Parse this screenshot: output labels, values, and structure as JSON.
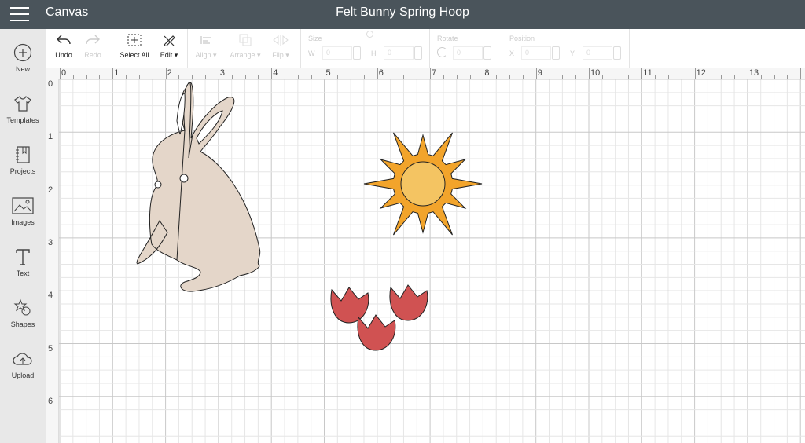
{
  "header": {
    "app": "Canvas",
    "title": "Felt Bunny Spring Hoop"
  },
  "sidebar": {
    "items": [
      {
        "label": "New",
        "icon": "plus-circle-icon"
      },
      {
        "label": "Templates",
        "icon": "tshirt-icon"
      },
      {
        "label": "Projects",
        "icon": "notebook-icon"
      },
      {
        "label": "Images",
        "icon": "image-icon"
      },
      {
        "label": "Text",
        "icon": "text-icon"
      },
      {
        "label": "Shapes",
        "icon": "shapes-icon"
      },
      {
        "label": "Upload",
        "icon": "cloud-upload-icon"
      }
    ]
  },
  "toolbar": {
    "undo": "Undo",
    "redo": "Redo",
    "select_all": "Select All",
    "edit": "Edit",
    "align": "Align",
    "arrange": "Arrange",
    "flip": "Flip",
    "size": "Size",
    "w": "W",
    "h": "H",
    "w_value": "0",
    "h_value": "0",
    "rotate": "Rotate",
    "rotate_value": "0",
    "position": "Position",
    "x": "X",
    "y": "Y",
    "x_value": "0",
    "y_value": "0"
  },
  "ruler": {
    "top": [
      "0",
      "1",
      "2",
      "3",
      "4",
      "5",
      "6",
      "7",
      "8",
      "9",
      "10",
      "11",
      "12",
      "13"
    ],
    "left": [
      "0",
      "1",
      "2",
      "3",
      "4",
      "5",
      "6"
    ]
  },
  "colors": {
    "topbar": "#4a545b",
    "bunny": "#e4d6c9",
    "sun_rays": "#f2a42b",
    "sun_center": "#f4c462",
    "tulip": "#d05252"
  }
}
